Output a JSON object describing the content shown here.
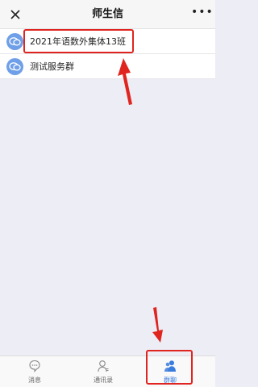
{
  "header": {
    "title": "师生信",
    "close_icon": "close-icon",
    "more_icon": "more-icon"
  },
  "groups": [
    {
      "name": "2021年语数外集体13班",
      "icon": "group-chat-icon"
    },
    {
      "name": "测试服务群",
      "icon": "group-chat-icon"
    }
  ],
  "tabs": [
    {
      "label": "消息",
      "icon": "message-icon"
    },
    {
      "label": "通讯录",
      "icon": "contacts-icon"
    },
    {
      "label": "群聊",
      "icon": "group-icon",
      "active": true
    }
  ],
  "colors": {
    "accent": "#3a7bde",
    "annotation": "#e0241f",
    "avatar": "#6e9fe8",
    "background": "#ecedf5"
  }
}
